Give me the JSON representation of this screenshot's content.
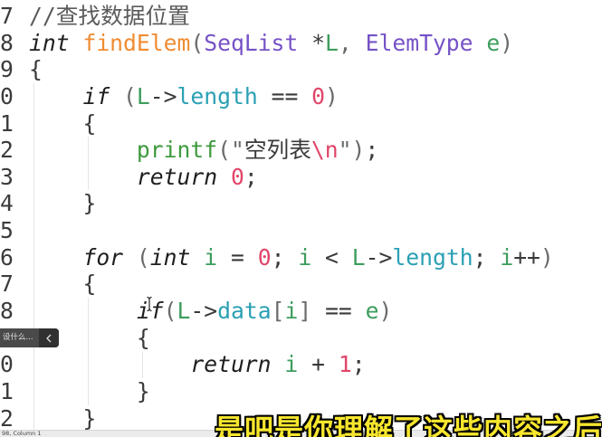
{
  "editor": {
    "lines": [
      {
        "num": "7",
        "tokens": [
          {
            "t": "//查找数据位置",
            "k": "comment"
          }
        ]
      },
      {
        "num": "8",
        "tokens": [
          {
            "t": "int ",
            "k": "keyword"
          },
          {
            "t": "findElem",
            "k": "function"
          },
          {
            "t": "(",
            "k": "punctuation"
          },
          {
            "t": "SeqList ",
            "k": "type"
          },
          {
            "t": "*",
            "k": "operator"
          },
          {
            "t": "L",
            "k": "variable"
          },
          {
            "t": ", ",
            "k": "punctuation"
          },
          {
            "t": "ElemType ",
            "k": "type"
          },
          {
            "t": "e",
            "k": "variable"
          },
          {
            "t": ")",
            "k": "punctuation"
          }
        ]
      },
      {
        "num": "9",
        "tokens": [
          {
            "t": "{",
            "k": "operator"
          }
        ]
      },
      {
        "num": "0",
        "tokens": [
          {
            "t": "    if ",
            "k": "keyword"
          },
          {
            "t": "(",
            "k": "punctuation"
          },
          {
            "t": "L",
            "k": "variable"
          },
          {
            "t": "->",
            "k": "operator"
          },
          {
            "t": "length",
            "k": "field"
          },
          {
            "t": " == ",
            "k": "operator"
          },
          {
            "t": "0",
            "k": "number"
          },
          {
            "t": ")",
            "k": "punctuation"
          }
        ]
      },
      {
        "num": "1",
        "tokens": [
          {
            "t": "    {",
            "k": "operator"
          }
        ]
      },
      {
        "num": "2",
        "tokens": [
          {
            "t": "        printf",
            "k": "call"
          },
          {
            "t": "(\"",
            "k": "punctuation"
          },
          {
            "t": "空列表",
            "k": "string"
          },
          {
            "t": "\\n",
            "k": "escape"
          },
          {
            "t": "\")",
            "k": "punctuation"
          },
          {
            "t": ";",
            "k": "operator"
          }
        ]
      },
      {
        "num": "3",
        "tokens": [
          {
            "t": "        return ",
            "k": "keyword"
          },
          {
            "t": "0",
            "k": "number"
          },
          {
            "t": ";",
            "k": "operator"
          }
        ]
      },
      {
        "num": "4",
        "tokens": [
          {
            "t": "    }",
            "k": "operator"
          }
        ]
      },
      {
        "num": "5",
        "tokens": []
      },
      {
        "num": "6",
        "tokens": [
          {
            "t": "    for ",
            "k": "keyword"
          },
          {
            "t": "(",
            "k": "punctuation"
          },
          {
            "t": "int ",
            "k": "keyword"
          },
          {
            "t": "i",
            "k": "variable"
          },
          {
            "t": " = ",
            "k": "operator"
          },
          {
            "t": "0",
            "k": "number"
          },
          {
            "t": "; ",
            "k": "operator"
          },
          {
            "t": "i",
            "k": "variable"
          },
          {
            "t": " < ",
            "k": "operator"
          },
          {
            "t": "L",
            "k": "variable"
          },
          {
            "t": "->",
            "k": "operator"
          },
          {
            "t": "length",
            "k": "field"
          },
          {
            "t": "; ",
            "k": "operator"
          },
          {
            "t": "i",
            "k": "variable"
          },
          {
            "t": "++",
            "k": "operator"
          },
          {
            "t": ")",
            "k": "punctuation"
          }
        ]
      },
      {
        "num": "7",
        "tokens": [
          {
            "t": "    {",
            "k": "operator"
          }
        ]
      },
      {
        "num": "8",
        "tokens": [
          {
            "t": "        if",
            "k": "keyword"
          },
          {
            "t": "(",
            "k": "punctuation"
          },
          {
            "t": "L",
            "k": "variable"
          },
          {
            "t": "->",
            "k": "operator"
          },
          {
            "t": "data",
            "k": "field"
          },
          {
            "t": "[",
            "k": "punctuation"
          },
          {
            "t": "i",
            "k": "variable"
          },
          {
            "t": "]",
            "k": "punctuation"
          },
          {
            "t": " == ",
            "k": "operator"
          },
          {
            "t": "e",
            "k": "variable"
          },
          {
            "t": ")",
            "k": "punctuation"
          }
        ]
      },
      {
        "tokens": [
          {
            "t": "        {",
            "k": "operator"
          }
        ]
      },
      {
        "num": "0",
        "tokens": [
          {
            "t": "            return ",
            "k": "keyword"
          },
          {
            "t": "i",
            "k": "variable"
          },
          {
            "t": " + ",
            "k": "operator"
          },
          {
            "t": "1",
            "k": "number"
          },
          {
            "t": ";",
            "k": "operator"
          }
        ]
      },
      {
        "num": "1",
        "tokens": [
          {
            "t": "        }",
            "k": "operator"
          }
        ]
      },
      {
        "num": "2",
        "tokens": [
          {
            "t": "    }",
            "k": "operator"
          }
        ]
      }
    ]
  },
  "syntax_colors": {
    "comment": "#5b5b5b",
    "keyword": "#1e1e1e",
    "function": "#ef8c32",
    "type": "#7652c6",
    "operator": "#3a3a3a",
    "punctuation": "#6a6a6a",
    "variable": "#3c9d5d",
    "field": "#2aa0b4",
    "number": "#e14568",
    "call": "#3e9a3e",
    "string": "#3a3a3a",
    "escape": "#e14568"
  },
  "pointer_icon": "ibeam-cursor-icon",
  "sidebar_popup": {
    "label": "设什么...",
    "toggle_icon": "chevron-left-icon"
  },
  "status_bar": {
    "position": "98, Column 1"
  },
  "subtitle": {
    "text": "是吧是你理解了这些内容之后",
    "color": "#f7e62e"
  }
}
